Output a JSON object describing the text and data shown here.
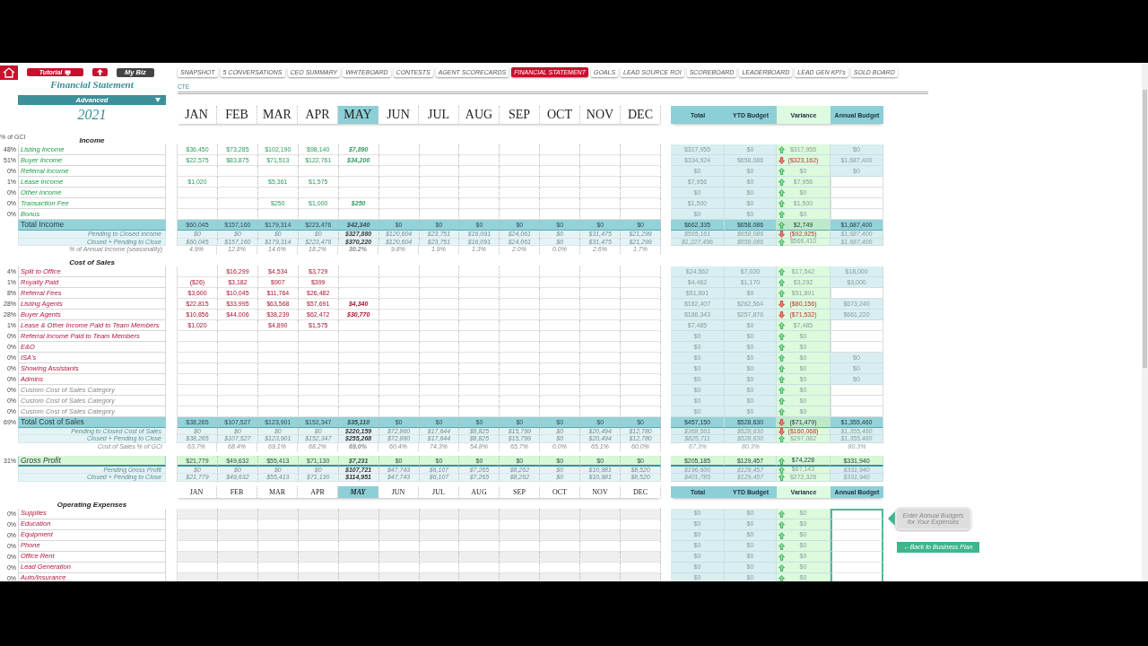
{
  "nav": {
    "buttons": [
      {
        "kind": "home"
      },
      {
        "kind": "tutorial",
        "label": "Tutorial"
      },
      {
        "kind": "up"
      },
      {
        "kind": "mybiz",
        "label": "My Biz"
      }
    ],
    "tabs": [
      {
        "label": "SNAPSHOT",
        "selected": false
      },
      {
        "label": "5 CONVERSATIONS",
        "selected": false
      },
      {
        "label": "CEO SUMMARY",
        "selected": false
      },
      {
        "label": "WHITEBOARD",
        "selected": false
      },
      {
        "label": "CONTESTS",
        "selected": false
      },
      {
        "label": "AGENT SCORECARDS",
        "selected": false
      },
      {
        "label": "FINANCIAL STATEMENT",
        "selected": true
      },
      {
        "label": "GOALS",
        "selected": false
      },
      {
        "label": "LEAD SOURCE ROI",
        "selected": false
      },
      {
        "label": "SCOREBOARD",
        "selected": false
      },
      {
        "label": "LEADERBOARD",
        "selected": false
      },
      {
        "label": "LEAD GEN KPI's",
        "selected": false
      },
      {
        "label": "SOLD BOARD",
        "selected": false
      }
    ]
  },
  "title": "Financial Statement",
  "subtitle": "CTE",
  "view": "Advanced",
  "year": "2021",
  "pct_heading": "% of GCI",
  "header": {
    "months": [
      {
        "label": "JAN",
        "selected": false
      },
      {
        "label": "FEB",
        "selected": false
      },
      {
        "label": "MAR",
        "selected": false
      },
      {
        "label": "APR",
        "selected": false
      },
      {
        "label": "MAY",
        "selected": true
      },
      {
        "label": "JUN",
        "selected": false
      },
      {
        "label": "JUL",
        "selected": false
      },
      {
        "label": "AUG",
        "selected": false
      },
      {
        "label": "SEP",
        "selected": false
      },
      {
        "label": "OCT",
        "selected": false
      },
      {
        "label": "NOV",
        "selected": false
      },
      {
        "label": "DEC",
        "selected": false
      }
    ],
    "columns": [
      "Total",
      "YTD Budget",
      "Variance",
      "Annual Budget"
    ]
  },
  "sections": [
    {
      "kind": "income",
      "title": "Income",
      "rows": [
        {
          "kind": "item",
          "pct": "48%",
          "label": "Listing Income",
          "months": [
            {
              "value": "$36,450"
            },
            {
              "value": "$73,285"
            },
            {
              "value": "$102,190"
            },
            {
              "value": "$98,140"
            },
            {
              "value": "$7,890"
            }
          ],
          "total": "$317,955",
          "ytd": "$0",
          "up": true,
          "variance": "$317,955",
          "annual": "$0"
        },
        {
          "kind": "item",
          "pct": "51%",
          "label": "Buyer Income",
          "months": [
            {
              "value": "$22,575"
            },
            {
              "value": "$83,875"
            },
            {
              "value": "$71,513"
            },
            {
              "value": "$122,761"
            },
            {
              "value": "$34,200"
            }
          ],
          "total": "$334,924",
          "ytd": "$658,086",
          "up": false,
          "variance": "($323,162)",
          "annual": "$1,687,400"
        },
        {
          "kind": "item",
          "pct": "0%",
          "label": "Referral Income",
          "total": "$0",
          "ytd": "$0",
          "up": true,
          "variance": "$0",
          "annual": "$0"
        },
        {
          "kind": "item",
          "pct": "1%",
          "label": "Lease Income",
          "months": [
            {
              "value": "$1,020"
            },
            {
              "empty": true
            },
            {
              "value": "$5,361"
            },
            {
              "value": "$1,575"
            }
          ],
          "total": "$7,956",
          "ytd": "$0",
          "up": true,
          "variance": "$7,956"
        },
        {
          "kind": "item",
          "pct": "0%",
          "label": "Other Income",
          "total": "$0",
          "ytd": "$0",
          "up": true,
          "variance": "$0"
        },
        {
          "kind": "item",
          "pct": "0%",
          "label": "Transaction Fee",
          "months": [
            {
              "empty": true
            },
            {
              "empty": true
            },
            {
              "value": "$250"
            },
            {
              "value": "$1,000"
            },
            {
              "value": "$250"
            }
          ],
          "total": "$1,500",
          "ytd": "$0",
          "up": true,
          "variance": "$1,500"
        },
        {
          "kind": "item",
          "pct": "0%",
          "label": "Bonus",
          "total": "$0",
          "ytd": "$0",
          "up": true,
          "variance": "$0"
        },
        {
          "kind": "total",
          "label": "Total Income",
          "months": [
            {
              "value": "$60,045"
            },
            {
              "value": "$157,160"
            },
            {
              "value": "$179,314"
            },
            {
              "value": "$223,476"
            },
            {
              "value": "$42,340"
            },
            {
              "value": "$0"
            },
            {
              "value": "$0"
            },
            {
              "value": "$0"
            },
            {
              "value": "$0"
            },
            {
              "value": "$0"
            },
            {
              "value": "$0"
            },
            {
              "value": "$0"
            }
          ],
          "total": "$662,335",
          "ytd": "$658,086",
          "up": true,
          "variance": "$2,749",
          "annual": "$1,687,400"
        },
        {
          "kind": "sub",
          "label": "Pending to Closed Income",
          "months": [
            {
              "value": "$0"
            },
            {
              "value": "$0"
            },
            {
              "value": "$0"
            },
            {
              "value": "$0"
            },
            {
              "value": "$327,880"
            },
            {
              "value": "$120,604"
            },
            {
              "value": "$23,751"
            },
            {
              "value": "$16,091"
            },
            {
              "value": "$24,061"
            },
            {
              "value": "$0"
            },
            {
              "value": "$31,475"
            },
            {
              "value": "$21,299"
            }
          ],
          "total": "$565,161",
          "ytd": "$658,086",
          "up": false,
          "variance": "($92,925)",
          "annual": "$1,687,400"
        },
        {
          "kind": "sub",
          "label": "Closed + Pending to Close",
          "months": [
            {
              "value": "$60,045"
            },
            {
              "value": "$157,160"
            },
            {
              "value": "$179,314"
            },
            {
              "value": "$223,476"
            },
            {
              "value": "$370,220"
            },
            {
              "value": "$120,604"
            },
            {
              "value": "$23,751"
            },
            {
              "value": "$16,091"
            },
            {
              "value": "$24,061"
            },
            {
              "value": "$0"
            },
            {
              "value": "$31,475"
            },
            {
              "value": "$21,299"
            }
          ],
          "total": "$1,227,496",
          "ytd": "$658,086",
          "up": true,
          "variance": "$569,410",
          "annual": "$1,687,400"
        },
        {
          "kind": "ratio",
          "label": "% of Annual Income (seasonality)",
          "months": [
            {
              "value": "4.9%"
            },
            {
              "value": "12.8%"
            },
            {
              "value": "14.6%"
            },
            {
              "value": "18.2%"
            },
            {
              "value": "30.2%"
            },
            {
              "value": "9.8%"
            },
            {
              "value": "1.9%"
            },
            {
              "value": "1.3%"
            },
            {
              "value": "2.0%"
            },
            {
              "value": "0.0%"
            },
            {
              "value": "2.6%"
            },
            {
              "value": "1.7%"
            }
          ]
        }
      ]
    },
    {
      "kind": "cost",
      "title": "Cost of Sales",
      "rows": [
        {
          "kind": "item",
          "pct": "4%",
          "label": "Split  to Office",
          "months": [
            {
              "empty": true
            },
            {
              "value": "$16,299"
            },
            {
              "value": "$4,534"
            },
            {
              "value": "$3,729"
            }
          ],
          "total": "$24,562",
          "ytd": "$7,020",
          "up": true,
          "variance": "$17,542",
          "annual": "$18,000"
        },
        {
          "kind": "item",
          "pct": "1%",
          "label": "Royalty Paid",
          "months": [
            {
              "value": "($26)"
            },
            {
              "value": "$3,182"
            },
            {
              "value": "$907"
            },
            {
              "value": "$399"
            }
          ],
          "total": "$4,462",
          "ytd": "$1,170",
          "up": true,
          "variance": "$3,292",
          "annual": "$3,000"
        },
        {
          "kind": "item",
          "pct": "8%",
          "label": "Referral Fees",
          "months": [
            {
              "value": "$3,600"
            },
            {
              "value": "$10,045"
            },
            {
              "value": "$11,764"
            },
            {
              "value": "$26,482"
            }
          ],
          "total": "$51,891",
          "ytd": "$0",
          "up": true,
          "variance": "$51,891"
        },
        {
          "kind": "item",
          "pct": "28%",
          "label": "Listing Agents",
          "months": [
            {
              "value": "$22,815"
            },
            {
              "value": "$33,995"
            },
            {
              "value": "$63,568"
            },
            {
              "value": "$57,691"
            },
            {
              "value": "$4,340"
            }
          ],
          "total": "$182,407",
          "ytd": "$262,564",
          "up": false,
          "variance": "($80,156)",
          "annual": "$673,240"
        },
        {
          "kind": "item",
          "pct": "28%",
          "label": "Buyer Agents",
          "months": [
            {
              "value": "$10,856"
            },
            {
              "value": "$44,006"
            },
            {
              "value": "$38,239"
            },
            {
              "value": "$62,472"
            },
            {
              "value": "$30,770"
            }
          ],
          "total": "$186,343",
          "ytd": "$257,876",
          "up": false,
          "variance": "($71,532)",
          "annual": "$661,220"
        },
        {
          "kind": "item",
          "pct": "1%",
          "label": "Lease & Other Income Paid to Team Members",
          "months": [
            {
              "value": "$1,020"
            },
            {
              "empty": true
            },
            {
              "value": "$4,890"
            },
            {
              "value": "$1,575"
            }
          ],
          "total": "$7,485",
          "ytd": "$0",
          "up": true,
          "variance": "$7,485"
        },
        {
          "kind": "item",
          "pct": "0%",
          "label": "Referral Income Paid to Team Members",
          "total": "$0",
          "ytd": "$0",
          "up": true,
          "variance": "$0"
        },
        {
          "kind": "item",
          "pct": "0%",
          "label": "E&O",
          "total": "$0",
          "ytd": "$0",
          "up": true,
          "variance": "$0"
        },
        {
          "kind": "item",
          "pct": "0%",
          "label": "ISA's",
          "total": "$0",
          "ytd": "$0",
          "up": true,
          "variance": "$0",
          "annual": "$0"
        },
        {
          "kind": "item",
          "pct": "0%",
          "label": "Showing Assistants",
          "total": "$0",
          "ytd": "$0",
          "up": true,
          "variance": "$0",
          "annual": "$0"
        },
        {
          "kind": "item",
          "pct": "0%",
          "label": "Admins",
          "total": "$0",
          "ytd": "$0",
          "up": true,
          "variance": "$0",
          "annual": "$0"
        },
        {
          "kind": "custom",
          "pct": "0%",
          "label": "Custom Cost of Sales Category",
          "total": "$0",
          "ytd": "$0",
          "up": true,
          "variance": "$0"
        },
        {
          "kind": "custom",
          "pct": "0%",
          "label": "Custom Cost of Sales Category",
          "total": "$0",
          "ytd": "$0",
          "up": true,
          "variance": "$0"
        },
        {
          "kind": "custom",
          "pct": "0%",
          "label": "Custom Cost of Sales Category",
          "total": "$0",
          "ytd": "$0",
          "up": true,
          "variance": "$0"
        },
        {
          "kind": "total",
          "pct": "69%",
          "label": "Total Cost of Sales",
          "months": [
            {
              "value": "$38,265"
            },
            {
              "value": "$107,527"
            },
            {
              "value": "$123,901"
            },
            {
              "value": "$152,347"
            },
            {
              "value": "$35,110"
            },
            {
              "value": "$0"
            },
            {
              "value": "$0"
            },
            {
              "value": "$0"
            },
            {
              "value": "$0"
            },
            {
              "value": "$0"
            },
            {
              "value": "$0"
            },
            {
              "value": "$0"
            }
          ],
          "total": "$457,150",
          "ytd": "$528,630",
          "up": false,
          "variance": "($71,479)",
          "annual": "$1,355,460"
        },
        {
          "kind": "sub",
          "label": "Pending to Closed Cost of Sales",
          "months": [
            {
              "value": "$0"
            },
            {
              "value": "$0"
            },
            {
              "value": "$0"
            },
            {
              "value": "$0"
            },
            {
              "value": "$220,159"
            },
            {
              "value": "$72,860"
            },
            {
              "value": "$17,644"
            },
            {
              "value": "$8,825"
            },
            {
              "value": "$15,799"
            },
            {
              "value": "$0"
            },
            {
              "value": "$20,494"
            },
            {
              "value": "$12,780"
            }
          ],
          "total": "$368,561",
          "ytd": "$528,630",
          "up": false,
          "variance": "($160,068)",
          "annual": "$1,355,460"
        },
        {
          "kind": "sub",
          "label": "Closed + Pending to Close",
          "months": [
            {
              "value": "$38,265"
            },
            {
              "value": "$107,527"
            },
            {
              "value": "$123,901"
            },
            {
              "value": "$152,347"
            },
            {
              "value": "$255,268"
            },
            {
              "value": "$72,860"
            },
            {
              "value": "$17,644"
            },
            {
              "value": "$8,825"
            },
            {
              "value": "$15,799"
            },
            {
              "value": "$0"
            },
            {
              "value": "$20,494"
            },
            {
              "value": "$12,780"
            }
          ],
          "total": "$825,711",
          "ytd": "$528,630",
          "up": true,
          "variance": "$297,082",
          "annual": "$1,355,460"
        },
        {
          "kind": "ratio",
          "label": "Cost of Sales % of GCI",
          "months": [
            {
              "value": "63.7%"
            },
            {
              "value": "68.4%"
            },
            {
              "value": "69.1%"
            },
            {
              "value": "68.2%"
            },
            {
              "value": "69.0%"
            },
            {
              "value": "60.4%"
            },
            {
              "value": "74.3%"
            },
            {
              "value": "54.8%"
            },
            {
              "value": "65.7%"
            },
            {
              "value": "0.0%"
            },
            {
              "value": "65.1%"
            },
            {
              "value": "60.0%"
            }
          ],
          "total": "67.3%",
          "ytd": "80.3%",
          "annual": "80.3%"
        }
      ]
    },
    {
      "kind": "profit",
      "rows": [
        {
          "kind": "total",
          "pct": "31%",
          "label": "Gross Profit",
          "months": [
            {
              "value": "$21,779"
            },
            {
              "value": "$49,632"
            },
            {
              "value": "$55,413"
            },
            {
              "value": "$71,130"
            },
            {
              "value": "$7,231"
            },
            {
              "value": "$0"
            },
            {
              "value": "$0"
            },
            {
              "value": "$0"
            },
            {
              "value": "$0"
            },
            {
              "value": "$0"
            },
            {
              "value": "$0"
            },
            {
              "value": "$0"
            }
          ],
          "total": "$205,185",
          "ytd": "$129,457",
          "up": true,
          "variance": "$74,228",
          "annual": "$331,940"
        },
        {
          "kind": "sub",
          "label": "Pending Gross Profit",
          "months": [
            {
              "value": "$0"
            },
            {
              "value": "$0"
            },
            {
              "value": "$0"
            },
            {
              "value": "$0"
            },
            {
              "value": "$107,721"
            },
            {
              "value": "$47,743"
            },
            {
              "value": "$6,107"
            },
            {
              "value": "$7,265"
            },
            {
              "value": "$8,262"
            },
            {
              "value": "$0"
            },
            {
              "value": "$10,981"
            },
            {
              "value": "$8,520"
            }
          ],
          "total": "$196,600",
          "ytd": "$129,457",
          "up": true,
          "variance": "$67,143",
          "annual": "$331,940"
        },
        {
          "kind": "sub",
          "label": "Closed + Pending to Close",
          "months": [
            {
              "value": "$21,779"
            },
            {
              "value": "$49,632"
            },
            {
              "value": "$55,413"
            },
            {
              "value": "$71,130"
            },
            {
              "value": "$114,951"
            },
            {
              "value": "$47,743"
            },
            {
              "value": "$6,107"
            },
            {
              "value": "$7,265"
            },
            {
              "value": "$8,262"
            },
            {
              "value": "$0"
            },
            {
              "value": "$10,981"
            },
            {
              "value": "$8,520"
            }
          ],
          "total": "$401,785",
          "ytd": "$129,457",
          "up": true,
          "variance": "$272,328",
          "annual": "$331,940"
        }
      ]
    },
    {
      "kind": "expenses",
      "title": "Operating Expenses",
      "header": {
        "months": [
          {
            "label": "JAN",
            "selected": false
          },
          {
            "label": "FEB",
            "selected": false
          },
          {
            "label": "MAR",
            "selected": false
          },
          {
            "label": "APR",
            "selected": false
          },
          {
            "label": "MAY",
            "selected": true
          },
          {
            "label": "JUN",
            "selected": false
          },
          {
            "label": "JUL",
            "selected": false
          },
          {
            "label": "AUG",
            "selected": false
          },
          {
            "label": "SEP",
            "selected": false
          },
          {
            "label": "OCT",
            "selected": false
          },
          {
            "label": "NOV",
            "selected": false
          },
          {
            "label": "DEC",
            "selected": false
          }
        ],
        "columns": [
          "Total",
          "YTD Budget",
          "Variance",
          "Annual Budget"
        ]
      },
      "callout": "Enter Annual Budgets for Your Expenses",
      "back_button": "←Back to Business Plan",
      "rows": [
        {
          "kind": "item",
          "pct": "0%",
          "label": "Supplies",
          "total": "$0",
          "ytd": "$0",
          "up": true,
          "variance": "$0"
        },
        {
          "kind": "item",
          "pct": "0%",
          "label": "Education",
          "total": "$0",
          "ytd": "$0",
          "up": true,
          "variance": "$0"
        },
        {
          "kind": "item",
          "pct": "0%",
          "label": "Equipment",
          "total": "$0",
          "ytd": "$0",
          "up": true,
          "variance": "$0"
        },
        {
          "kind": "item",
          "pct": "0%",
          "label": "Phone",
          "total": "$0",
          "ytd": "$0",
          "up": true,
          "variance": "$0"
        },
        {
          "kind": "item",
          "pct": "0%",
          "label": "Office Rent",
          "total": "$0",
          "ytd": "$0",
          "up": true,
          "variance": "$0"
        },
        {
          "kind": "item",
          "pct": "0%",
          "label": "Lead Generation",
          "total": "$0",
          "ytd": "$0",
          "up": true,
          "variance": "$0"
        },
        {
          "kind": "item",
          "pct": "0%",
          "label": "Auto/Insurance",
          "total": "$0",
          "ytd": "$0",
          "up": true,
          "variance": "$0"
        }
      ]
    }
  ]
}
